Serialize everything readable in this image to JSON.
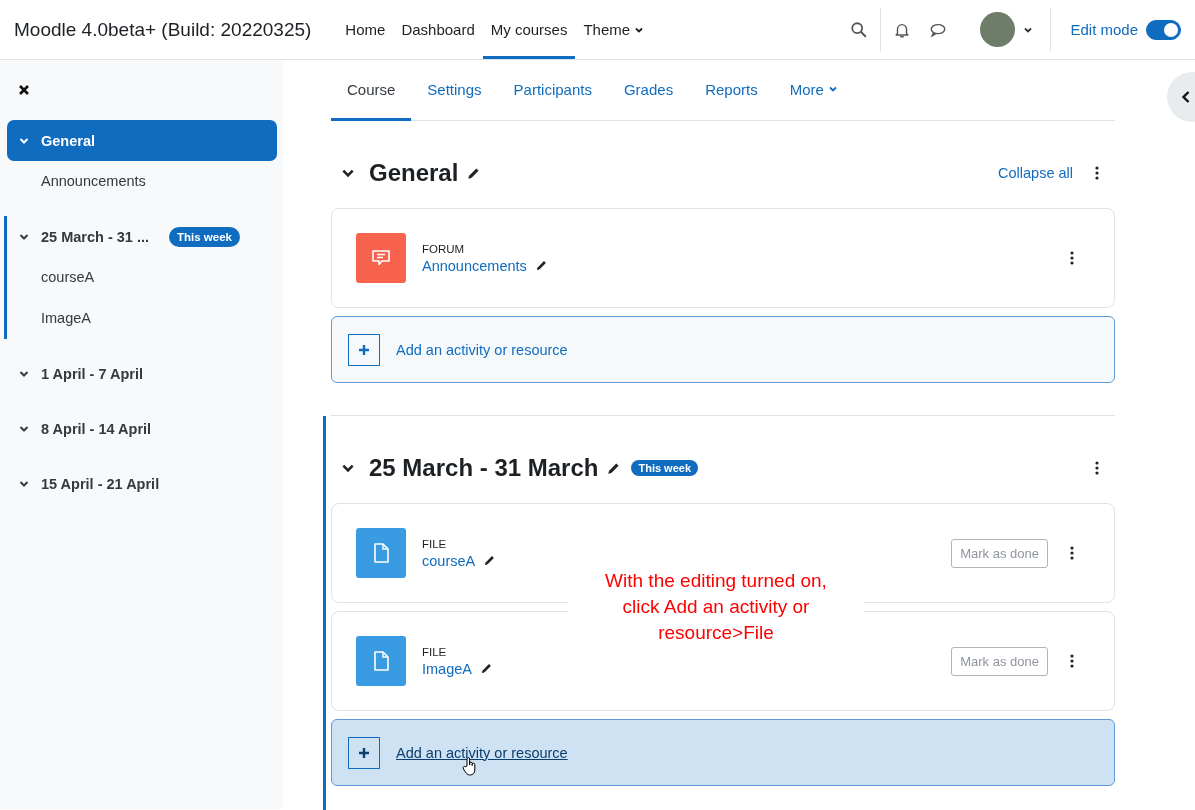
{
  "site_title": "Moodle 4.0beta+ (Build: 20220325)",
  "nav": [
    {
      "label": "Home",
      "selected": false,
      "dropdown": false
    },
    {
      "label": "Dashboard",
      "selected": false,
      "dropdown": false
    },
    {
      "label": "My courses",
      "selected": true,
      "dropdown": false
    },
    {
      "label": "Theme",
      "selected": false,
      "dropdown": true
    }
  ],
  "edit_mode": {
    "label": "Edit mode",
    "on": true
  },
  "course_index": [
    {
      "title": "General",
      "selected": true,
      "current": false,
      "items": [
        "Announcements"
      ]
    },
    {
      "title": "25 March - 31 ...",
      "selected": false,
      "current": true,
      "badge": "This week",
      "items": [
        "courseA",
        "ImageA"
      ]
    },
    {
      "title": "1 April - 7 April",
      "selected": false,
      "current": false
    },
    {
      "title": "8 April - 14 April",
      "selected": false,
      "current": false
    },
    {
      "title": "15 April - 21 April",
      "selected": false,
      "current": false
    }
  ],
  "tabs": [
    {
      "label": "Course",
      "selected": true,
      "dropdown": false
    },
    {
      "label": "Settings",
      "selected": false,
      "dropdown": false
    },
    {
      "label": "Participants",
      "selected": false,
      "dropdown": false
    },
    {
      "label": "Grades",
      "selected": false,
      "dropdown": false
    },
    {
      "label": "Reports",
      "selected": false,
      "dropdown": false
    },
    {
      "label": "More",
      "selected": false,
      "dropdown": true
    }
  ],
  "sections": [
    {
      "title": "General",
      "current": false,
      "action_link": "Collapse all",
      "activities": [
        {
          "kind": "forum",
          "type": "FORUM",
          "name": "Announcements"
        }
      ],
      "add_activity": {
        "label": "Add an activity or resource",
        "hovered": false
      }
    },
    {
      "title": "25 March - 31 March",
      "current": true,
      "badge": "This week",
      "activities": [
        {
          "kind": "file",
          "type": "FILE",
          "name": "courseA",
          "completion": "Mark as done"
        },
        {
          "kind": "file",
          "type": "FILE",
          "name": "ImageA",
          "completion": "Mark as done"
        }
      ],
      "add_activity": {
        "label": "Add an activity or resource",
        "hovered": true
      }
    }
  ],
  "annotation": [
    "With the editing turned on,",
    "click Add an activity or",
    "resource>File"
  ]
}
